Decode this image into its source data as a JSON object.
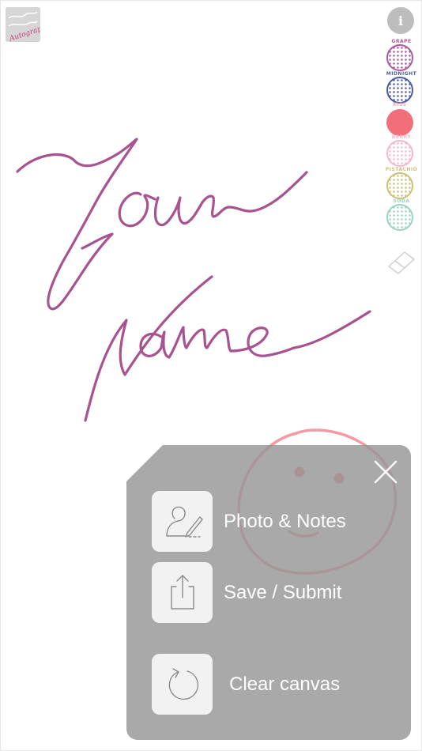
{
  "app": {
    "logo_icon": "autograph-logo",
    "logo_text": "Autograph"
  },
  "toolbar": {
    "info_label": "i",
    "colors": [
      {
        "name": "GRAPE",
        "color": "#a85a9f",
        "style": "dotted"
      },
      {
        "name": "MIDNIGHT",
        "color": "#4b5aa4",
        "style": "dotted"
      },
      {
        "name": "KISS",
        "color": "#f06f7a",
        "style": "solid",
        "selected": true
      },
      {
        "name": "BERRY",
        "color": "#f7b6cf",
        "style": "dotted"
      },
      {
        "name": "PISTACHIO",
        "color": "#cdbf79",
        "style": "dotted"
      },
      {
        "name": "SODA",
        "color": "#9bd3c2",
        "style": "dotted"
      }
    ],
    "eraser_icon": "eraser-icon"
  },
  "canvas": {
    "handwriting_text": "Your Name",
    "ink_color": "#a8528f",
    "doodle": "smiley-face",
    "doodle_color": "#f06f7a"
  },
  "menu": {
    "close_icon": "close-icon",
    "items": [
      {
        "label": "Photo & Notes",
        "icon": "signature-person-icon"
      },
      {
        "label": "Save / Submit",
        "icon": "share-icon"
      },
      {
        "label": "Clear canvas",
        "icon": "reset-icon"
      }
    ]
  }
}
